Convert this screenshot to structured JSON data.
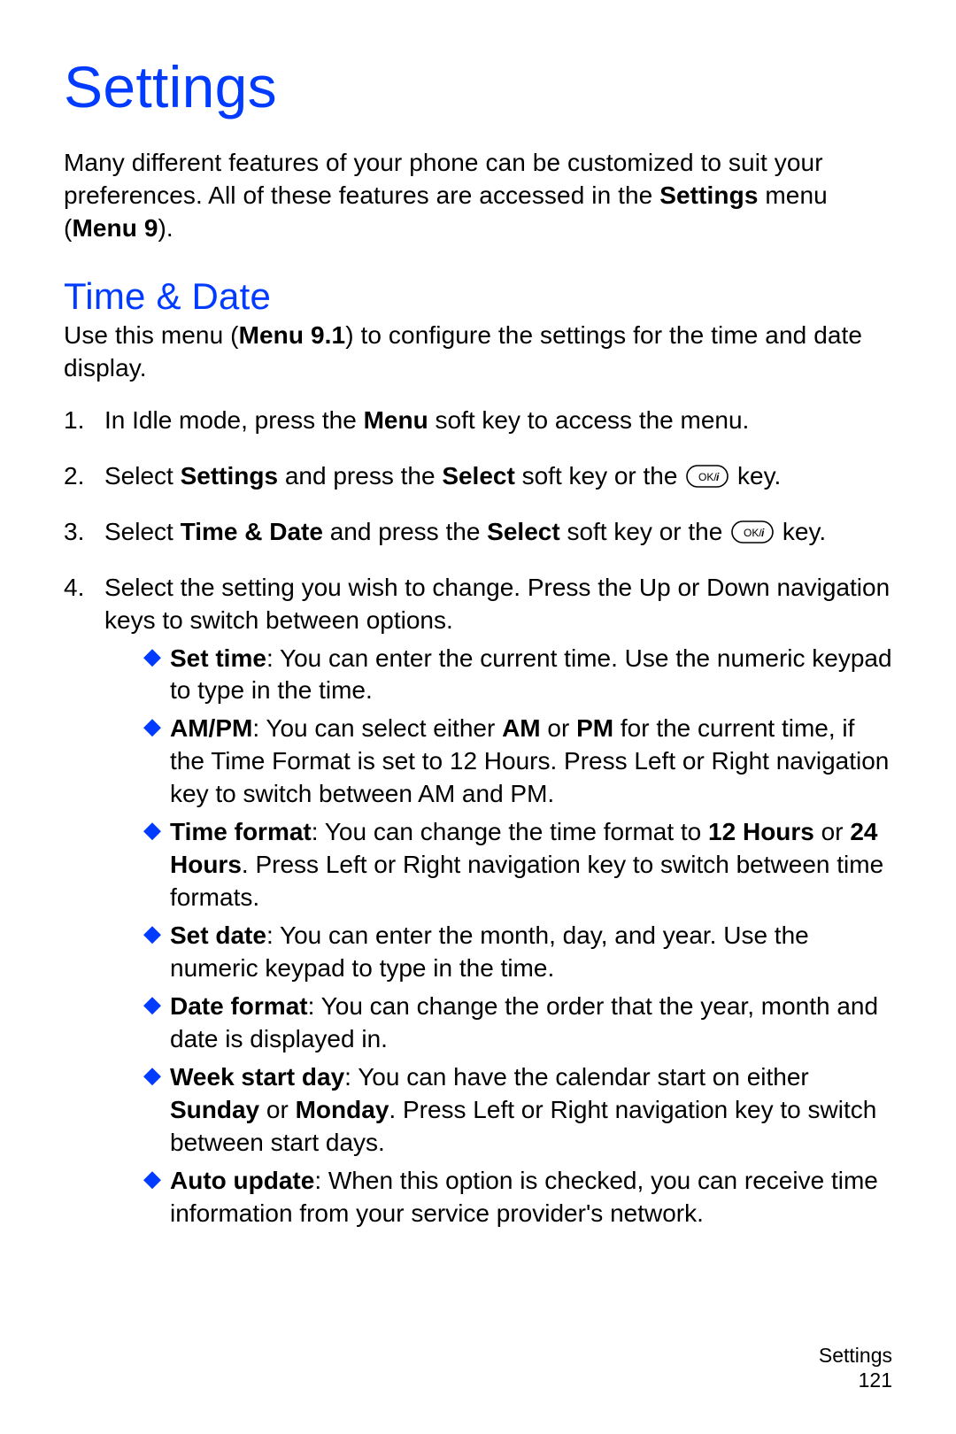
{
  "title": "Settings",
  "intro": {
    "before": "Many different features of your phone can be customized to suit your preferences. All of these features are accessed in the ",
    "bold1": "Settings",
    "mid": " menu (",
    "bold2": "Menu 9",
    "after": ")."
  },
  "section": {
    "heading": "Time & Date",
    "desc_before": "Use this menu (",
    "desc_bold": "Menu 9.1",
    "desc_after": ") to configure the settings for the time and date display."
  },
  "steps": {
    "s1": {
      "num": "1.",
      "a": "In Idle mode, press the ",
      "b1": "Menu",
      "c": " soft key to access the menu."
    },
    "s2": {
      "num": "2.",
      "a": "Select ",
      "b1": "Settings",
      "c": " and press the ",
      "b2": "Select",
      "d": " soft key or the ",
      "e": " key."
    },
    "s3": {
      "num": "3.",
      "a": "Select ",
      "b1": "Time & Date",
      "c": " and press the ",
      "b2": "Select",
      "d": " soft key or the ",
      "e": " key."
    },
    "s4": {
      "num": "4.",
      "text": "Select the setting you wish to change. Press the Up or Down navigation keys to switch between options."
    }
  },
  "bullets": {
    "b1": {
      "label": "Set time",
      "text": ": You can enter the current time. Use the numeric keypad to type in the time."
    },
    "b2": {
      "label": "AM/PM",
      "t1": ": You can select either ",
      "bold1": "AM",
      "t2": " or ",
      "bold2": "PM",
      "t3": " for the current time, if the Time Format is set to 12 Hours. Press Left or Right navigation key to switch between AM and PM."
    },
    "b3": {
      "label": "Time format",
      "t1": ": You can change the time format to ",
      "bold1": "12 Hours",
      "t2": " or ",
      "bold2": "24 Hours",
      "t3": ". Press Left or Right navigation key to switch between time formats."
    },
    "b4": {
      "label": "Set date",
      "text": ": You can enter the month, day, and year. Use the numeric keypad to type in the time."
    },
    "b5": {
      "label": "Date format",
      "text": ": You can change the order that the year, month and date is displayed in."
    },
    "b6": {
      "label": "Week start day",
      "t1": ": You can have the calendar start on either ",
      "bold1": "Sunday",
      "t2": " or ",
      "bold2": "Monday",
      "t3": ". Press Left or Right navigation key to switch between start days."
    },
    "b7": {
      "label": "Auto update",
      "text": ": When this option is checked, you can receive time information from your service provider's network."
    }
  },
  "footer": {
    "section": "Settings",
    "page": "121"
  },
  "okkey_label": "OK/i"
}
